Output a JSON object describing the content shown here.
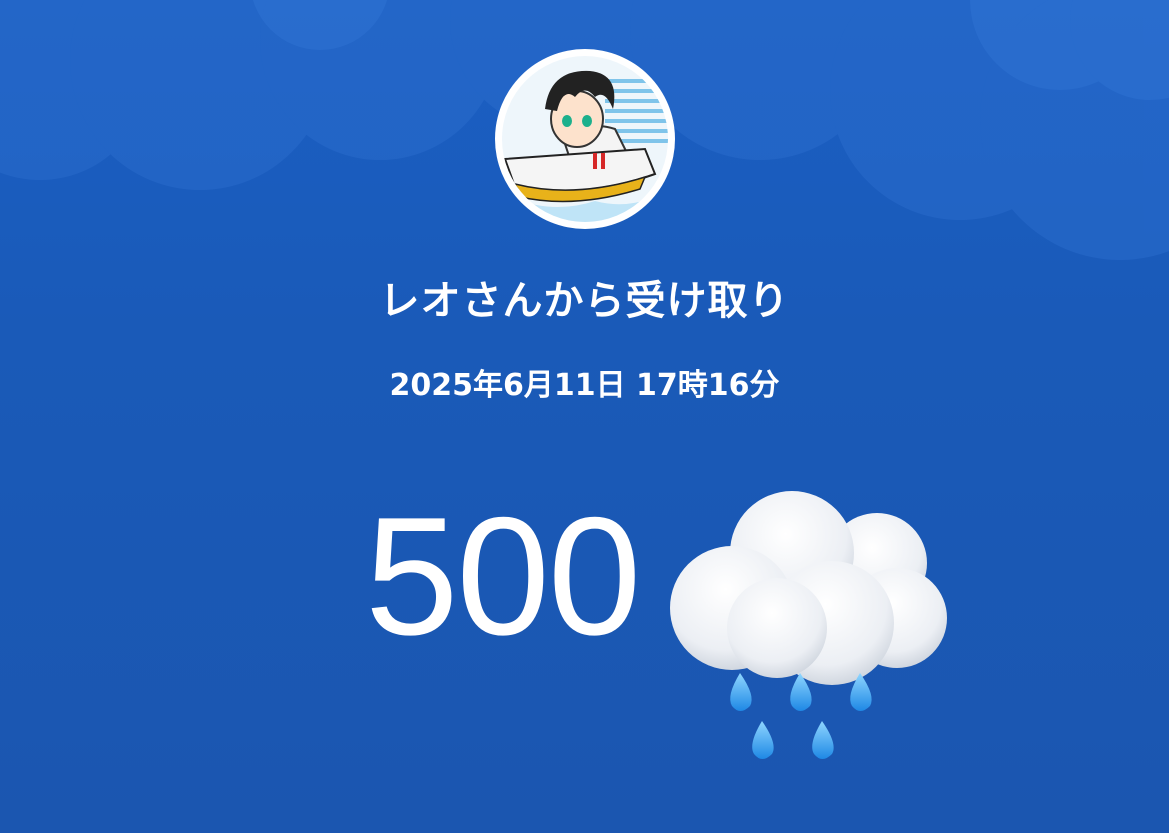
{
  "receipt": {
    "title": "レオさんから受け取り",
    "datetime": "2025年6月11日 17時16分",
    "amount": "500"
  },
  "icons": {
    "avatar": "avatar-boat-racer",
    "decoration": "cloud-with-rain-emoji"
  },
  "colors": {
    "background": "#1a5ab8",
    "text": "#ffffff"
  }
}
